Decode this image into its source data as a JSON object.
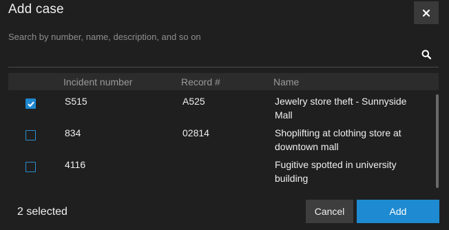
{
  "dialog": {
    "title": "Add case",
    "close_icon": "close-icon"
  },
  "search": {
    "placeholder": "Search by number, name, description, and so on",
    "value": "",
    "icon": "search-icon"
  },
  "table": {
    "columns": [
      "Incident number",
      "Record #",
      "Name"
    ],
    "rows": [
      {
        "checked": true,
        "incident": "S515",
        "record": "A525",
        "name": "Jewelry store theft - Sunnyside Mall"
      },
      {
        "checked": false,
        "incident": "834",
        "record": "02814",
        "name": "Shoplifting at clothing store at downtown mall"
      },
      {
        "checked": false,
        "incident": "4116",
        "record": "",
        "name": "Fugitive spotted in university building"
      }
    ]
  },
  "footer": {
    "selected_text": "2 selected",
    "cancel_label": "Cancel",
    "add_label": "Add"
  },
  "colors": {
    "background": "#1f1f1f",
    "accent": "#1e8ad1",
    "header_row": "#2c2c2c",
    "secondary_button": "#3e3e3e"
  }
}
